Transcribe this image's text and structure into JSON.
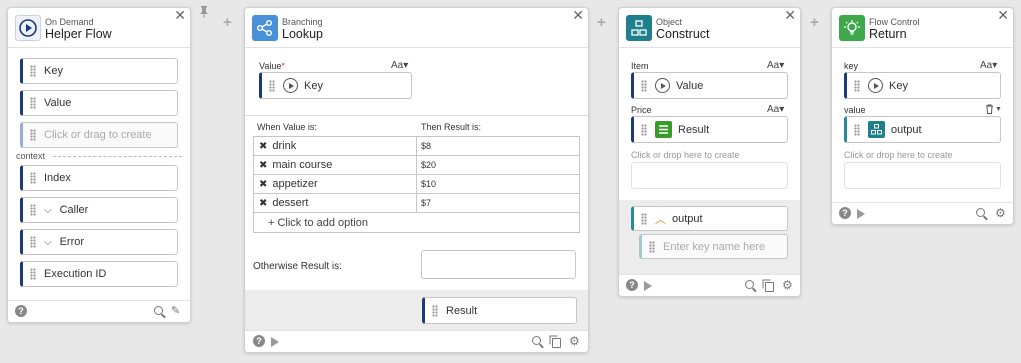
{
  "pin_icon": "pin-icon",
  "helper": {
    "sub": "On Demand",
    "title": "Helper Flow",
    "items": [
      "Key",
      "Value"
    ],
    "create_hint": "Click or drag to create",
    "context_label": "context",
    "context_items": [
      "Index",
      "Caller",
      "Error",
      "Execution ID"
    ]
  },
  "lookup": {
    "sub": "Branching",
    "title": "Lookup",
    "value_label": "Value",
    "required": "*",
    "aa": "Aa▾",
    "value_pill": "Key",
    "when_label": "When Value is:",
    "then_label": "Then Result is:",
    "rows": [
      {
        "key": "drink",
        "value": "$8"
      },
      {
        "key": "main course",
        "value": "$20"
      },
      {
        "key": "appetizer",
        "value": "$10"
      },
      {
        "key": "dessert",
        "value": "$7"
      }
    ],
    "add_option": "+ Click to add option",
    "otherwise_label": "Otherwise Result is:",
    "result_pill": "Result"
  },
  "construct": {
    "sub": "Object",
    "title": "Construct",
    "item_label": "Item",
    "item_pill": "Value",
    "price_label": "Price",
    "price_pill": "Result",
    "drop_hint": "Click or drop here to create",
    "output_pill": "output",
    "key_placeholder": "Enter key name here",
    "aa": "Aa▾"
  },
  "ret": {
    "sub": "Flow Control",
    "title": "Return",
    "key_label": "key",
    "key_pill": "Key",
    "value_label": "value",
    "value_pill": "output",
    "drop_hint": "Click or drop here to create",
    "aa": "Aa▾"
  },
  "colors": {
    "lookup": "#4a90d9",
    "construct": "#1f7f8c",
    "return": "#3fa84a",
    "accent": "#1a3a7a"
  }
}
